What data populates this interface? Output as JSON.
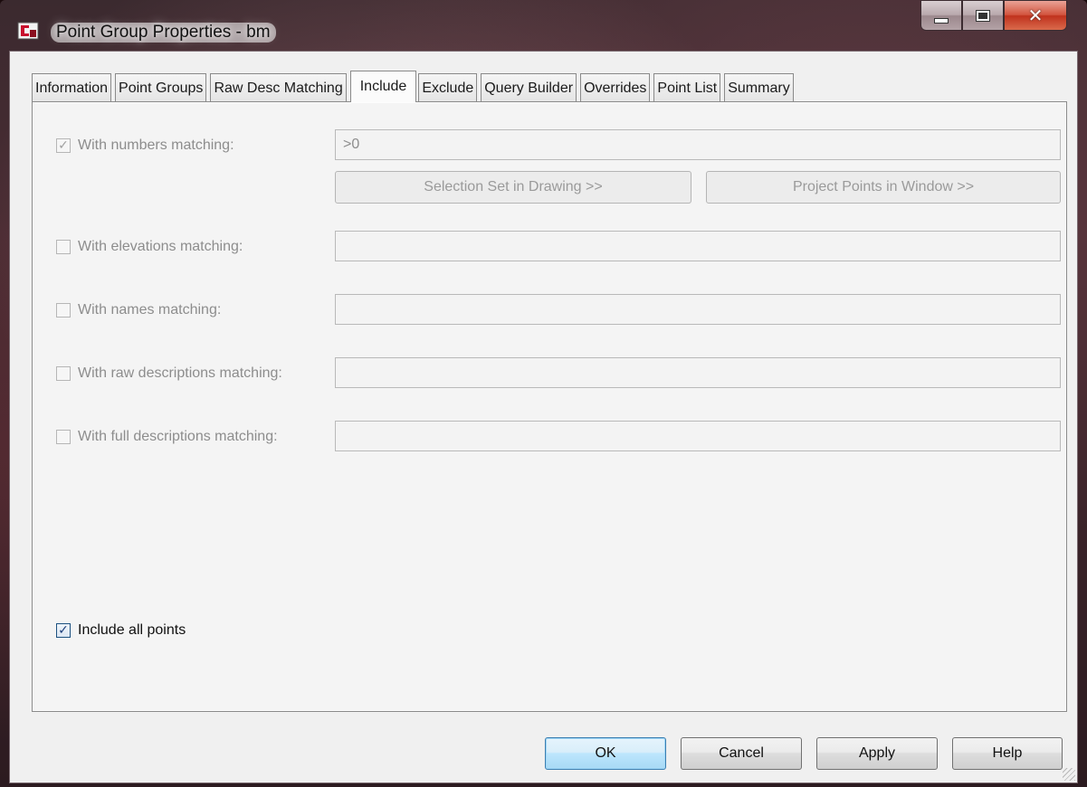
{
  "window": {
    "title": "Point Group Properties - bm",
    "icon": "civil3d-app-icon",
    "controls": {
      "minimize": "minimize-icon",
      "maximize": "maximize-icon",
      "close": "✕"
    }
  },
  "tabs": [
    {
      "label": "Information",
      "active": false
    },
    {
      "label": "Point Groups",
      "active": false
    },
    {
      "label": "Raw Desc Matching",
      "active": false
    },
    {
      "label": "Include",
      "active": true
    },
    {
      "label": "Exclude",
      "active": false
    },
    {
      "label": "Query Builder",
      "active": false
    },
    {
      "label": "Overrides",
      "active": false
    },
    {
      "label": "Point List",
      "active": false
    },
    {
      "label": "Summary",
      "active": false
    }
  ],
  "include": {
    "numbers": {
      "label": "With numbers matching:",
      "checked": true,
      "value": ">0"
    },
    "selection_set_button": "Selection Set in Drawing >>",
    "project_points_button": "Project Points in Window >>",
    "elevations": {
      "label": "With elevations matching:",
      "checked": false,
      "value": ""
    },
    "names": {
      "label": "With names matching:",
      "checked": false,
      "value": ""
    },
    "raw_descriptions": {
      "label": "With raw descriptions matching:",
      "checked": false,
      "value": ""
    },
    "full_descriptions": {
      "label": "With full descriptions matching:",
      "checked": false,
      "value": ""
    },
    "include_all": {
      "label": "Include all points",
      "checked": true
    }
  },
  "footer": {
    "ok": "OK",
    "cancel": "Cancel",
    "apply": "Apply",
    "help": "Help"
  },
  "colors": {
    "dialog_bg": "#f0f0f0",
    "default_button": "#bde6fd",
    "close_button": "#c0321d"
  }
}
